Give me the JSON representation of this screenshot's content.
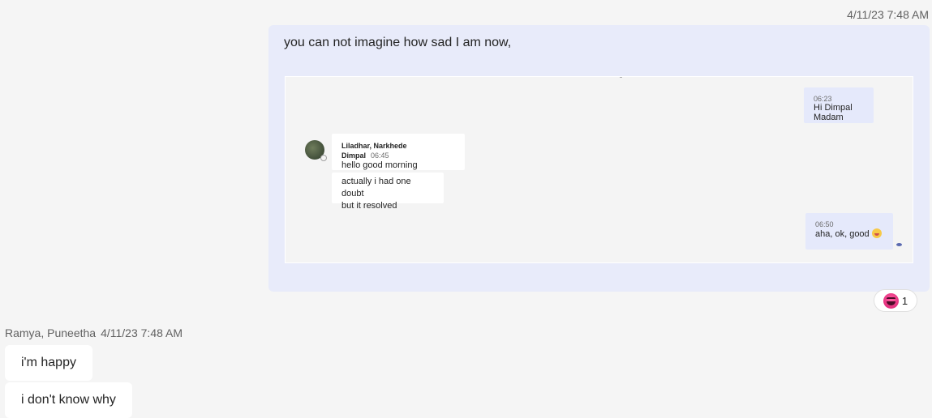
{
  "own_message": {
    "timestamp": "4/11/23 7:48 AM",
    "text": "you can not imagine how sad I am now,",
    "attachment": {
      "messages": [
        {
          "direction": "out",
          "time": "06:23",
          "text": "Hi Dimpal Madam"
        },
        {
          "direction": "in",
          "sender": "Liladhar, Narkhede Dimpal",
          "time": "06:45",
          "text": "hello good morning"
        },
        {
          "direction": "in",
          "text_lines": [
            "actually i had one doubt",
            "but it resolved"
          ]
        },
        {
          "direction": "out",
          "time": "06:50",
          "text": "aha, ok, good",
          "emoji": "grinning-face"
        }
      ]
    },
    "reaction": {
      "emoji": "laughing-face",
      "count": "1"
    }
  },
  "incoming": {
    "sender": "Ramya, Puneetha",
    "timestamp": "4/11/23 7:48 AM",
    "messages": [
      "i'm happy",
      "i don't know why"
    ]
  },
  "colors": {
    "background": "#f5f5f5",
    "own_bubble": "#e8ebfa",
    "incoming_bubble": "#ffffff",
    "meta_text": "#616161"
  }
}
